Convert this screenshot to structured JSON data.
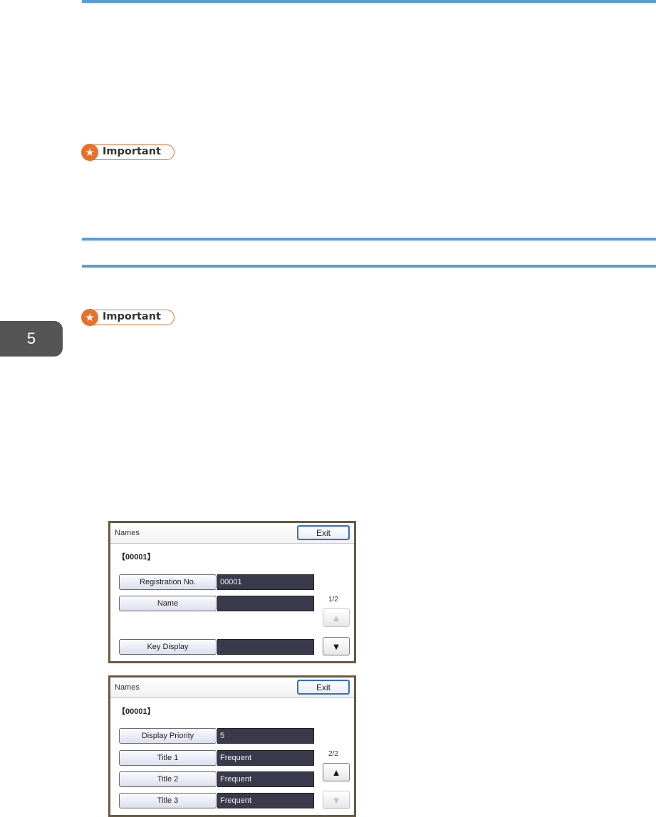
{
  "page": {
    "chapter_number": "5",
    "important_label_1": "Important",
    "important_label_2": "Important"
  },
  "panels": [
    {
      "title": "Names",
      "exit_label": "Exit",
      "record_id": "【00001】",
      "pager": "1/2",
      "fields": [
        {
          "label": "Registration No.",
          "value": "00001"
        },
        {
          "label": "Name",
          "value": ""
        },
        {
          "label": "Key Display",
          "value": ""
        }
      ],
      "up_enabled": false,
      "down_enabled": true
    },
    {
      "title": "Names",
      "exit_label": "Exit",
      "record_id": "【00001】",
      "pager": "2/2",
      "fields": [
        {
          "label": "Display Priority",
          "value": "5"
        },
        {
          "label": "Title 1",
          "value": "Frequent"
        },
        {
          "label": "Title 2",
          "value": "Frequent"
        },
        {
          "label": "Title 3",
          "value": "Frequent"
        }
      ],
      "up_enabled": true,
      "down_enabled": false
    }
  ],
  "icons": {
    "star": "star-icon",
    "up": "arrow-up-icon",
    "down": "arrow-down-icon"
  },
  "colors": {
    "accent_line": "#5b9bd5",
    "important_orange": "#e8702a",
    "value_field": "#3a3a4c"
  }
}
